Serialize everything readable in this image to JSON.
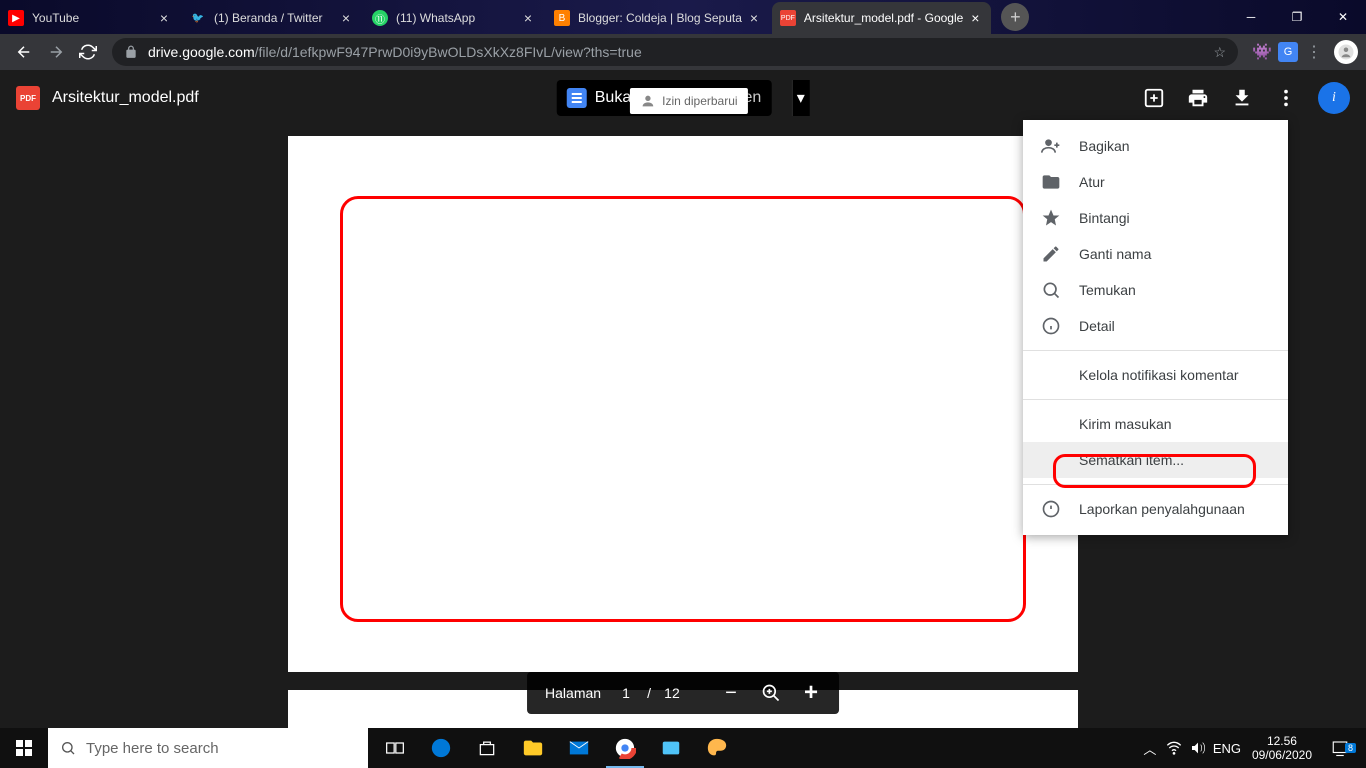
{
  "window": {
    "tabs": [
      {
        "title": "YouTube",
        "favicon": "youtube"
      },
      {
        "title": "(1) Beranda / Twitter",
        "favicon": "twitter"
      },
      {
        "title": "(11) WhatsApp",
        "favicon": "whatsapp"
      },
      {
        "title": "Blogger: Coldeja | Blog Seputa",
        "favicon": "blogger"
      },
      {
        "title": "Arsitektur_model.pdf - Google",
        "favicon": "pdf",
        "active": true
      }
    ],
    "url_host": "drive.google.com",
    "url_path": "/file/d/1efkpwF947PrwD0i9yBwOLDsXkXz8FIvL/view?ths=true"
  },
  "drive": {
    "filename": "Arsitektur_model.pdf",
    "pdf_badge": "PDF",
    "open_with_label": "Buka dengan Google Dokumen",
    "open_with_short": "Buka d",
    "tooltip": "Izin diperbarui",
    "page_label": "Halaman",
    "page_current": "1",
    "page_sep": "/",
    "page_total": "12"
  },
  "menu": {
    "items": [
      {
        "label": "Bagikan",
        "icon": "share"
      },
      {
        "label": "Atur",
        "icon": "folder"
      },
      {
        "label": "Bintangi",
        "icon": "star"
      },
      {
        "label": "Ganti nama",
        "icon": "rename"
      },
      {
        "label": "Temukan",
        "icon": "search"
      },
      {
        "label": "Detail",
        "icon": "info"
      }
    ],
    "notif_label": "Kelola notifikasi komentar",
    "feedback_label": "Kirim masukan",
    "embed_label": "Sematkan item...",
    "report_label": "Laporkan penyalahgunaan"
  },
  "taskbar": {
    "search_placeholder": "Type here to search",
    "lang": "ENG",
    "time": "12.56",
    "date": "09/06/2020",
    "notif_count": "8"
  }
}
